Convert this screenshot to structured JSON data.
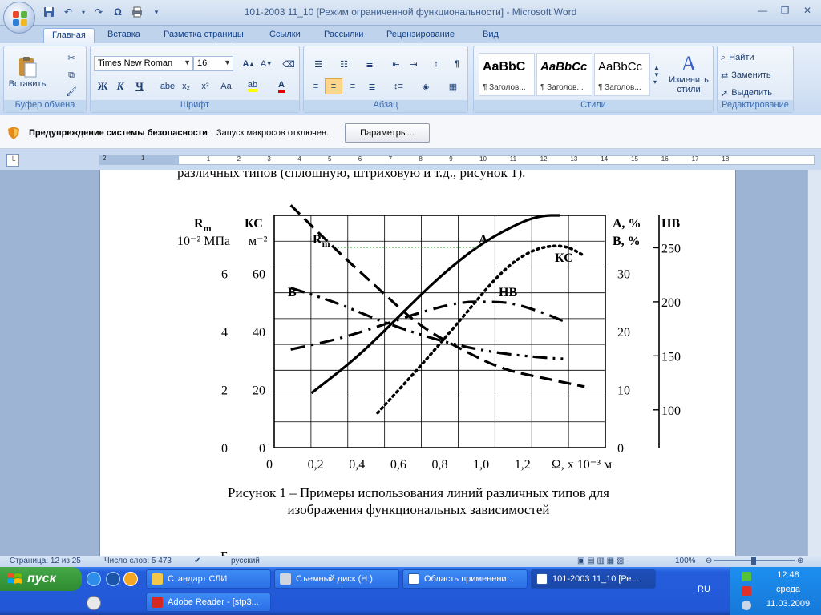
{
  "window": {
    "title": "101-2003 11_10 [Режим ограниченной функциональности] - Microsoft Word",
    "qat_icons": [
      "save-icon",
      "undo-icon",
      "redo-icon",
      "omega-icon",
      "print-icon",
      "customize-icon"
    ],
    "controls": [
      "minimize",
      "maximize",
      "close"
    ]
  },
  "tabs": [
    {
      "label": "Главная",
      "active": true
    },
    {
      "label": "Вставка"
    },
    {
      "label": "Разметка страницы"
    },
    {
      "label": "Ссылки"
    },
    {
      "label": "Рассылки"
    },
    {
      "label": "Рецензирование"
    },
    {
      "label": "Вид"
    }
  ],
  "ribbon": {
    "clipboard": {
      "label": "Буфер обмена",
      "paste": "Вставить"
    },
    "font": {
      "label": "Шрифт",
      "name": "Times New Roman",
      "size": "16",
      "bold": "Ж",
      "italic": "К",
      "underline": "Ч",
      "strike": "abe",
      "sub": "x₂",
      "sup": "x²",
      "case": "Aa"
    },
    "paragraph": {
      "label": "Абзац"
    },
    "styles": {
      "label": "Стили",
      "items": [
        {
          "sample": "AaBbC",
          "name": "¶ Заголов..."
        },
        {
          "sample": "AaBbCc",
          "name": "¶ Заголов..."
        },
        {
          "sample": "AaBbCc",
          "name": "¶ Заголов..."
        }
      ],
      "change": "Изменить",
      "change2": "стили"
    },
    "editing": {
      "label": "Редактирование",
      "find": "Найти",
      "replace": "Заменить",
      "select": "Выделить"
    }
  },
  "security": {
    "title": "Предупреждение системы безопасности",
    "message": "Запуск макросов отключен.",
    "button": "Параметры..."
  },
  "ruler": {
    "ticks": [
      "2",
      "1",
      "1",
      "2",
      "3",
      "4",
      "5",
      "6",
      "7",
      "8",
      "9",
      "10",
      "11",
      "12",
      "13",
      "14",
      "15",
      "16",
      "17",
      "18"
    ]
  },
  "document": {
    "top_line": "различных типов (сплошную, штриховую и т.д., рисунок 1).",
    "caption_line1": "Рисунок 1 – Примеры использования линий различных типов для",
    "caption_line2": "изображения функциональных зависимостей",
    "bottom_line": "Б"
  },
  "chart_data": {
    "type": "line",
    "x_ticks": [
      "0",
      "0,2",
      "0,4",
      "0,6",
      "0,8",
      "1,0",
      "1,2"
    ],
    "xlabel": "Ω, x 10⁻³ м",
    "axes": {
      "rm": {
        "title": "R",
        "title_sub": "m",
        "unit": "10⁻² МПа",
        "ticks": [
          "0",
          "2",
          "4",
          "6"
        ],
        "range": [
          0,
          8
        ]
      },
      "kc": {
        "title": "КС",
        "unit": "м⁻²",
        "ticks": [
          "0",
          "20",
          "40",
          "60"
        ],
        "range": [
          0,
          80
        ]
      },
      "a": {
        "title": "А, %",
        "unit": "В, %",
        "ticks": [
          "0",
          "10",
          "20",
          "30"
        ],
        "range": [
          0,
          40
        ]
      },
      "hb": {
        "title": "НВ",
        "ticks": [
          "100",
          "150",
          "200",
          "250"
        ],
        "range": [
          65,
          280
        ]
      }
    },
    "series": [
      {
        "name": "R",
        "name_sub": "m",
        "axis": "rm",
        "style": "dash",
        "x": [
          0.08,
          0.3,
          0.5,
          0.7,
          0.9,
          1.1,
          1.3,
          1.5
        ],
        "y": [
          8.35,
          6.8,
          5.5,
          4.2,
          3.4,
          2.7,
          2.4,
          2.1
        ]
      },
      {
        "name": "А",
        "axis": "a",
        "style": "solid",
        "x": [
          0.18,
          0.4,
          0.6,
          0.8,
          1.0,
          1.2,
          1.3,
          1.38
        ],
        "y": [
          9.4,
          15.5,
          22.5,
          29.5,
          35.2,
          39.0,
          40.0,
          40.0
        ]
      },
      {
        "name": "КС",
        "axis": "kc",
        "style": "dot",
        "x": [
          0.5,
          0.7,
          0.9,
          1.1,
          1.25,
          1.4,
          1.5
        ],
        "y": [
          12.0,
          27.5,
          44.0,
          61.0,
          68.5,
          70.0,
          66.0
        ]
      },
      {
        "name": "НВ",
        "axis": "hb",
        "style": "dashdot",
        "x": [
          0.08,
          0.3,
          0.5,
          0.7,
          0.9,
          1.05,
          1.15,
          1.3,
          1.4
        ],
        "y": [
          156,
          165,
          177,
          190,
          200,
          200,
          199,
          190,
          182
        ]
      },
      {
        "name": "В",
        "axis": "a",
        "style": "dashdotdot",
        "x": [
          0.08,
          0.3,
          0.5,
          0.7,
          0.9,
          1.1,
          1.3,
          1.4
        ],
        "y": [
          27.5,
          25.0,
          22.0,
          19.5,
          17.5,
          16.2,
          15.5,
          15.3
        ]
      }
    ],
    "legend": "inline labels"
  },
  "status": {
    "page": "Страница: 12 из 25",
    "words": "Число слов: 5 473",
    "lang": "русский",
    "zoom": "100%"
  },
  "taskbar": {
    "start": "пуск",
    "buttons": [
      {
        "label": "Стандарт СЛИ",
        "icon": "folder-icon"
      },
      {
        "label": "Съемный диск (H:)",
        "icon": "drive-icon"
      },
      {
        "label": "Область применени...",
        "icon": "word-icon"
      },
      {
        "label": "101-2003 11_10 [Ре...",
        "icon": "word-icon",
        "active": true
      },
      {
        "label": "Adobe Reader - [stp3...",
        "icon": "pdf-icon"
      }
    ],
    "lang": "RU",
    "time": "12:48",
    "day": "среда",
    "date": "11.03.2009"
  }
}
